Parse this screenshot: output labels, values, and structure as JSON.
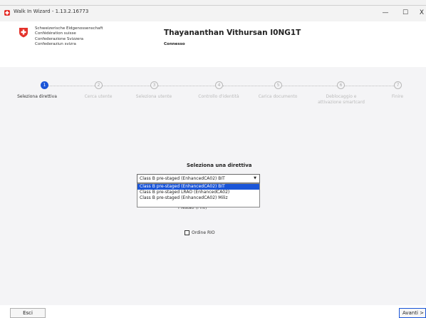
{
  "window": {
    "title": "Walk In Wizard - 1.13.2.16773",
    "minimize_glyph": "—",
    "maximize_glyph": "☐",
    "close_glyph": "X"
  },
  "header": {
    "agency_lines": [
      "Schweizerische Eidgenossenschaft",
      "Confédération suisse",
      "Confederazione Svizzera",
      "Confederaziun svizra"
    ],
    "user_name": "Thayananthan Vithursan I0NG1T",
    "status": "Connesso",
    "logo_colors": {
      "red": "#e4322b",
      "white": "#ffffff"
    }
  },
  "steps": [
    {
      "number": "1",
      "label": "Seleziona direttiva",
      "active": true
    },
    {
      "number": "2",
      "label": "Cerca utente",
      "active": false
    },
    {
      "number": "3",
      "label": "Seleziona utente",
      "active": false
    },
    {
      "number": "4",
      "label": "Controllo d'identità",
      "active": false
    },
    {
      "number": "5",
      "label": "Carica documento",
      "active": false
    },
    {
      "number": "6",
      "label": "Deblocaggio e attivazione smartcard",
      "active": false
    },
    {
      "number": "7",
      "label": "Finire",
      "active": false
    }
  ],
  "policy": {
    "title": "Seleziona una direttiva",
    "selected": "Class B pre-staged (EnhancedCA02) BIT",
    "options": [
      "Class B pre-staged (EnhancedCA02) BIT",
      "Class B pre-staged LRAO (EnhancedCA02)",
      "Class B pre-staged (EnhancedCA02) Miliz"
    ],
    "partially_hidden_label": "Prestati (Priv)"
  },
  "checkbox": {
    "label": "Ordine RIO",
    "checked": false
  },
  "footer": {
    "exit_label": "Esci",
    "next_label": "Avanti >"
  },
  "colors": {
    "accent": "#1a55d8",
    "panel_bg": "#f4f4f6"
  }
}
